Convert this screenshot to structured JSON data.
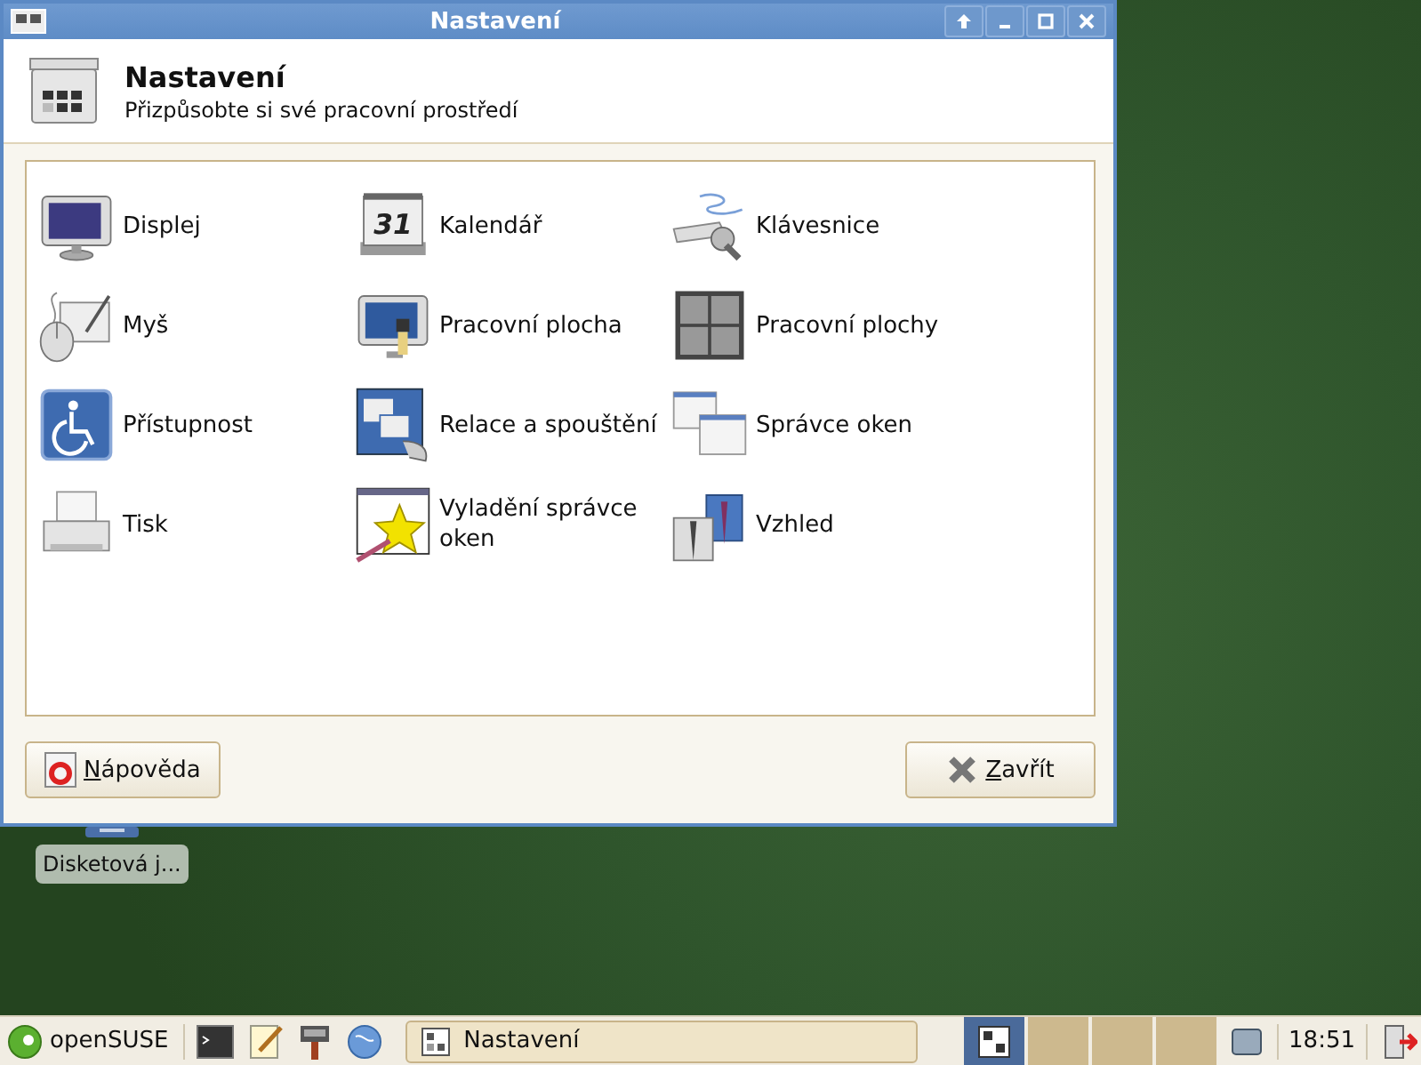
{
  "window": {
    "title": "Nastavení"
  },
  "header": {
    "title": "Nastavení",
    "subtitle": "Přizpůsobte si své pracovní prostředí"
  },
  "items": [
    {
      "label": "Displej",
      "kind": "display"
    },
    {
      "label": "Kalendář",
      "kind": "calendar",
      "badge": "31"
    },
    {
      "label": "Klávesnice",
      "kind": "keyboard"
    },
    {
      "label": "Myš",
      "kind": "mouse"
    },
    {
      "label": "Pracovní plocha",
      "kind": "desktop"
    },
    {
      "label": "Pracovní plochy",
      "kind": "workspaces"
    },
    {
      "label": "Přístupnost",
      "kind": "accessibility"
    },
    {
      "label": "Relace a spouštění",
      "kind": "session"
    },
    {
      "label": "Správce oken",
      "kind": "windows"
    },
    {
      "label": "Tisk",
      "kind": "printer"
    },
    {
      "label": "Vyladění správce oken",
      "kind": "tweaks"
    },
    {
      "label": "Vzhled",
      "kind": "appearance"
    }
  ],
  "buttons": [
    {
      "label": "Nápověda",
      "kind": "help"
    },
    {
      "label": "Zavřít",
      "kind": "close"
    }
  ],
  "desktop_icons": [
    {
      "label": "Disketová j..."
    }
  ],
  "taskbar": {
    "start": "openSUSE",
    "launchers": [
      {
        "kind": "terminal"
      },
      {
        "kind": "editor"
      },
      {
        "kind": "brush"
      },
      {
        "kind": "globe"
      }
    ],
    "tasks": [
      {
        "label": "Nastavení"
      }
    ],
    "workspaces": [
      {
        "selected": true
      },
      {
        "selected": false
      },
      {
        "selected": false
      },
      {
        "selected": false
      }
    ],
    "clock": "18:51"
  }
}
